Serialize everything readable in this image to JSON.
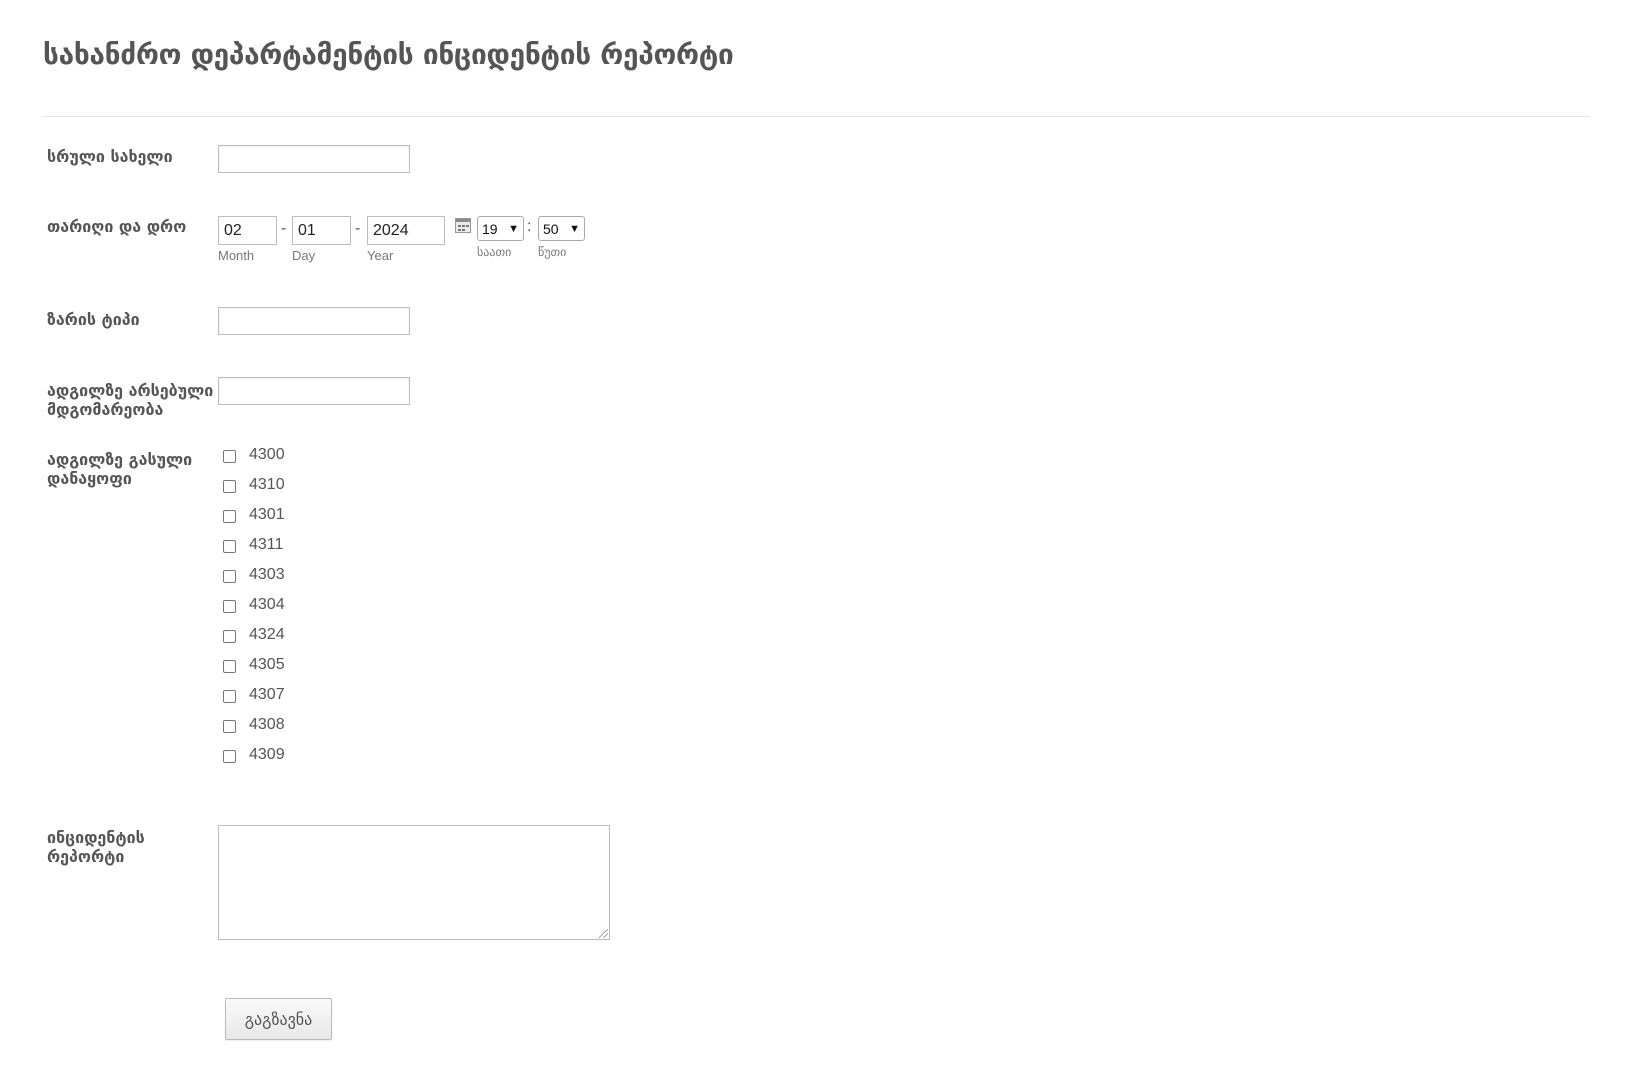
{
  "form": {
    "title": "სახანძრო დეპარტამენტის ინციდენტის რეპორტი",
    "full_name": {
      "label": "სრული სახელი",
      "value": ""
    },
    "datetime": {
      "label": "თარიღი და დრო",
      "month": "02",
      "day": "01",
      "year": "2024",
      "month_label": "Month",
      "day_label": "Day",
      "year_label": "Year",
      "separator": "-",
      "hour": "19",
      "minute": "50",
      "time_separator": ":",
      "hour_label": "საათი",
      "minute_label": "წუთი",
      "calendar_icon": "calendar-icon"
    },
    "alarm_type": {
      "label": "ზარის ტიპი",
      "value": ""
    },
    "on_site_condition": {
      "label": "ადგილზე არსებული მდგომარეობა",
      "value": ""
    },
    "units": {
      "label": "ადგილზე გასული დანაყოფი",
      "options": [
        "4300",
        "4310",
        "4301",
        "4311",
        "4303",
        "4304",
        "4324",
        "4305",
        "4307",
        "4308",
        "4309"
      ]
    },
    "incident_report": {
      "label": "ინციდენტის რეპორტი",
      "value": ""
    },
    "submit_label": "გაგზავნა"
  }
}
